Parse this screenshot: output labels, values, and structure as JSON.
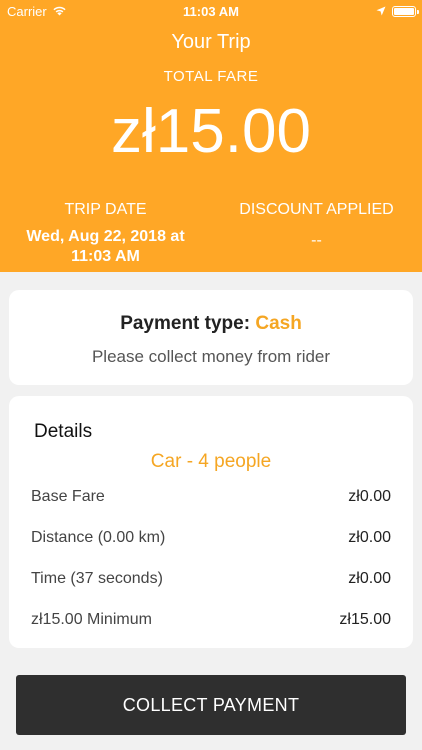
{
  "status_bar": {
    "carrier": "Carrier",
    "time": "11:03 AM"
  },
  "header": {
    "title": "Your Trip",
    "fare_label": "TOTAL FARE",
    "fare_amount": "zł15.00",
    "trip_date_label": "TRIP DATE",
    "trip_date_value": "Wed, Aug 22, 2018 at 11:03 AM",
    "discount_label": "DISCOUNT APPLIED",
    "discount_value": "--",
    "background_color": "#FFA726"
  },
  "payment": {
    "label": "Payment type:",
    "method": "Cash",
    "note": "Please collect money from rider",
    "accent_color": "#F5A623"
  },
  "details": {
    "title": "Details",
    "vehicle": "Car - 4 people",
    "rows": [
      {
        "label": "Base Fare",
        "amount": "zł0.00"
      },
      {
        "label": "Distance (0.00 km)",
        "amount": "zł0.00"
      },
      {
        "label": "Time (37 seconds)",
        "amount": "zł0.00"
      },
      {
        "label": "zł15.00 Minimum",
        "amount": "zł15.00"
      }
    ]
  },
  "action": {
    "collect_label": "COLLECT PAYMENT"
  },
  "icons": [
    "wifi-icon",
    "location-arrow-icon",
    "battery-icon"
  ]
}
